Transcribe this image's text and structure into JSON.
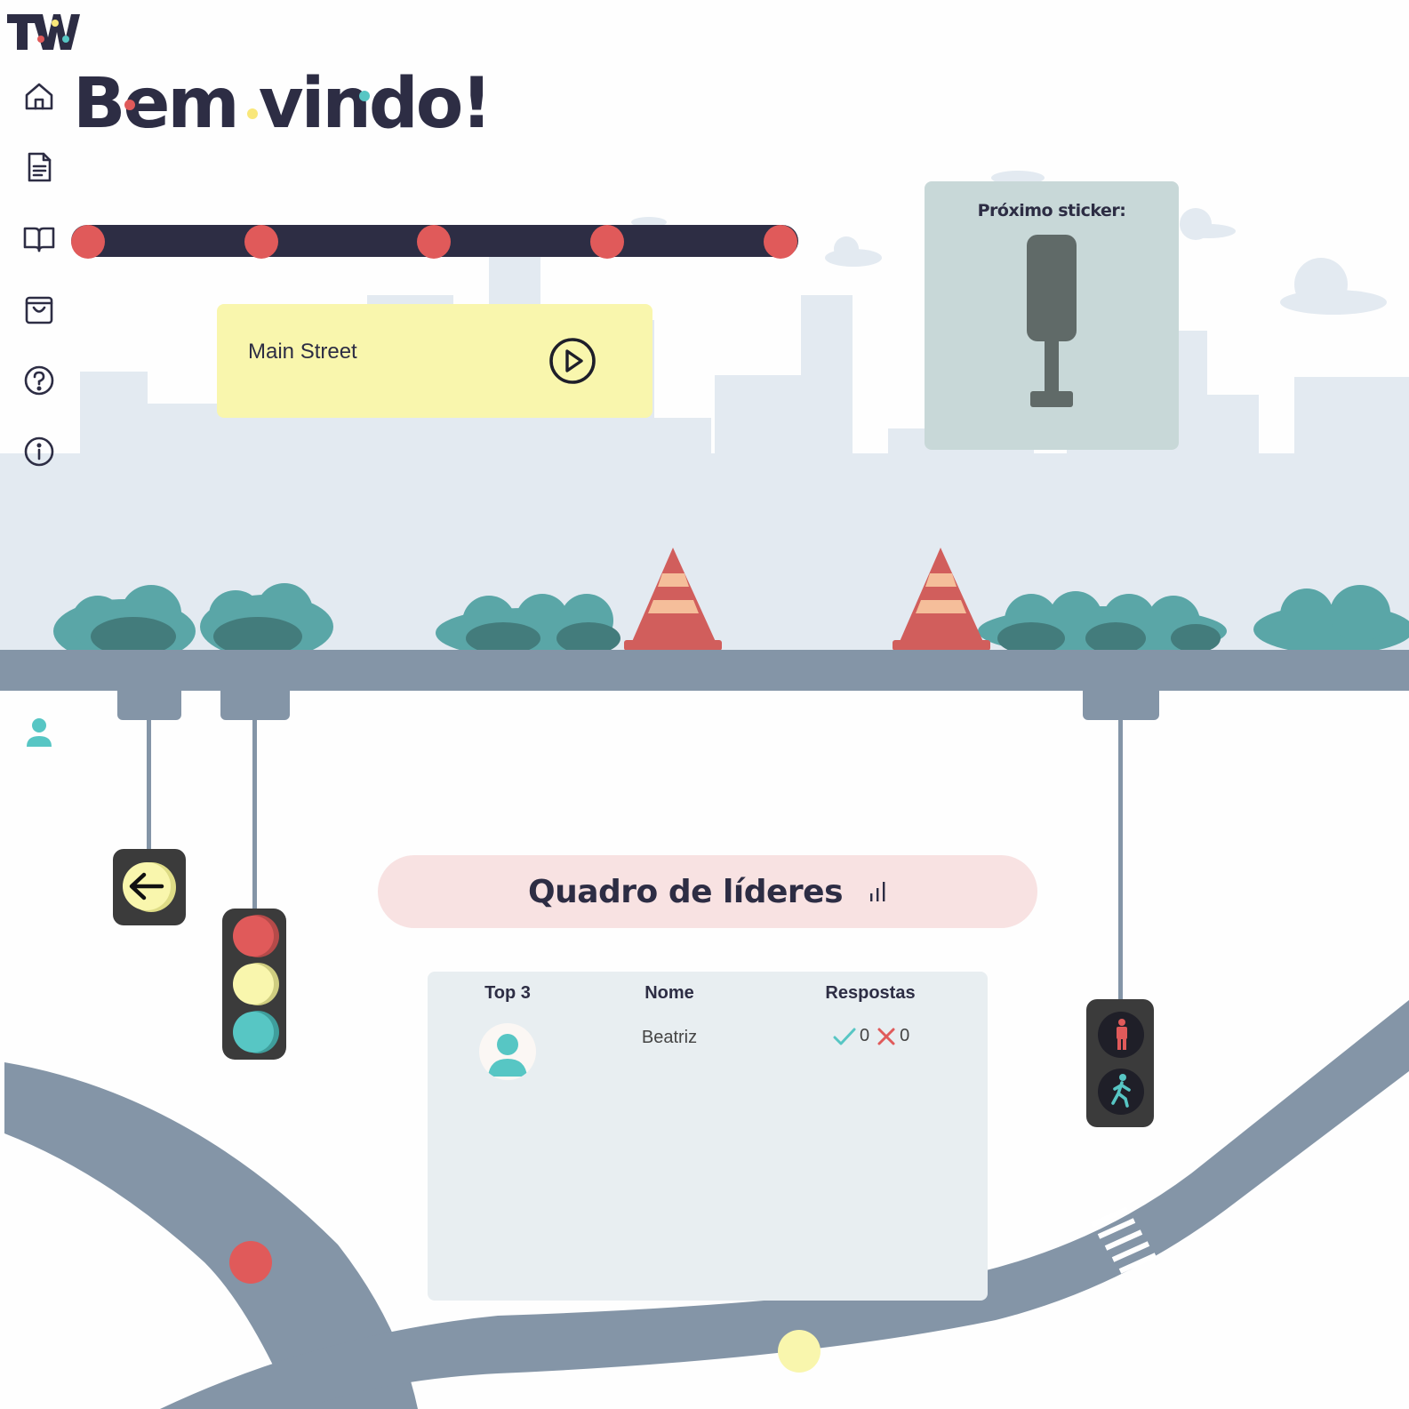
{
  "app": {
    "logo_text": "TW"
  },
  "colors": {
    "navy": "#2d2d44",
    "red": "#e05a5a",
    "yellow": "#f9f6ad",
    "teal": "#57c6c4",
    "road": "#8495a7",
    "city": "#e3eaf1",
    "bush": "#5aa6a7",
    "bush_dark": "#437c7c"
  },
  "sidebar": {
    "items": [
      {
        "icon": "home-icon"
      },
      {
        "icon": "document-icon"
      },
      {
        "icon": "book-icon"
      },
      {
        "icon": "shopping-bag-icon"
      },
      {
        "icon": "help-icon"
      },
      {
        "icon": "info-icon"
      }
    ],
    "user_icon": "user-icon"
  },
  "header": {
    "welcome": "Bem vindo!"
  },
  "progress": {
    "total_steps": 5,
    "completed_steps": 5
  },
  "level": {
    "name": "Main Street",
    "action_icon": "play-icon"
  },
  "sticker": {
    "title": "Próximo sticker:",
    "icon": "traffic-light-silhouette-icon"
  },
  "leaderboard": {
    "title": "Quadro de líderes",
    "icon": "bar-chart-icon",
    "columns": [
      "Top 3",
      "Nome",
      "Respostas"
    ],
    "rows": [
      {
        "avatar": "user-avatar-icon",
        "name": "Beatriz",
        "correct": "0",
        "wrong": "0"
      }
    ]
  }
}
